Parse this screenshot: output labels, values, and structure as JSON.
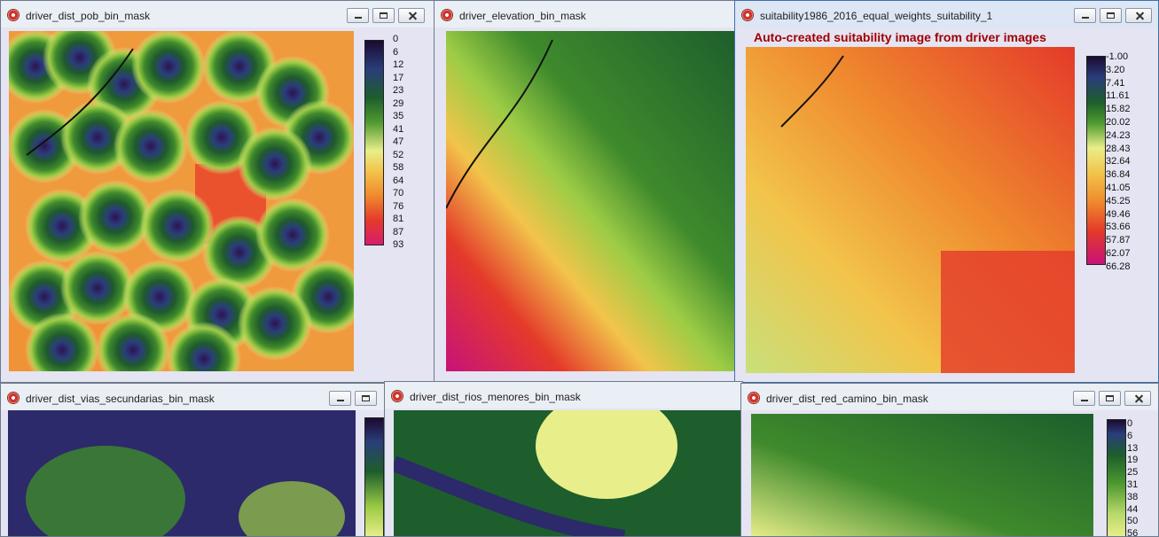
{
  "windows": {
    "pob": {
      "title": "driver_dist_pob_bin_mask",
      "legend": [
        "0",
        "6",
        "12",
        "17",
        "23",
        "29",
        "35",
        "41",
        "47",
        "52",
        "58",
        "64",
        "70",
        "76",
        "81",
        "87",
        "93"
      ]
    },
    "elevation": {
      "title": "driver_elevation_bin_mask"
    },
    "suitability": {
      "title": "suitability1986_2016_equal_weights_suitability_1",
      "subtitle": "Auto-created suitability image from driver images",
      "legend": [
        "-1.00",
        "3.20",
        "7.41",
        "11.61",
        "15.82",
        "20.02",
        "24.23",
        "28.43",
        "32.64",
        "36.84",
        "41.05",
        "45.25",
        "49.46",
        "53.66",
        "57.87",
        "62.07",
        "66.28"
      ]
    },
    "vias": {
      "title": "driver_dist_vias_secundarias_bin_mask"
    },
    "rios": {
      "title": "driver_dist_rios_menores_bin_mask"
    },
    "camino": {
      "title": "driver_dist_red_camino_bin_mask",
      "legend": [
        "0",
        "6",
        "13",
        "19",
        "25",
        "31",
        "38",
        "44",
        "50",
        "56"
      ]
    }
  },
  "palettes": {
    "distance": [
      "#2f1050",
      "#2c3a7a",
      "#1d5e2c",
      "#3f8a2c",
      "#8cc23a",
      "#e7ee8a",
      "#f2cc4c",
      "#f08a2e",
      "#e8402a",
      "#d81c60"
    ],
    "suitability": [
      "#2a0e3c",
      "#1d5e2c",
      "#7cb83a",
      "#e8ee8a",
      "#f2c44a",
      "#ef8a2e",
      "#e43a2a",
      "#c8127a"
    ]
  }
}
